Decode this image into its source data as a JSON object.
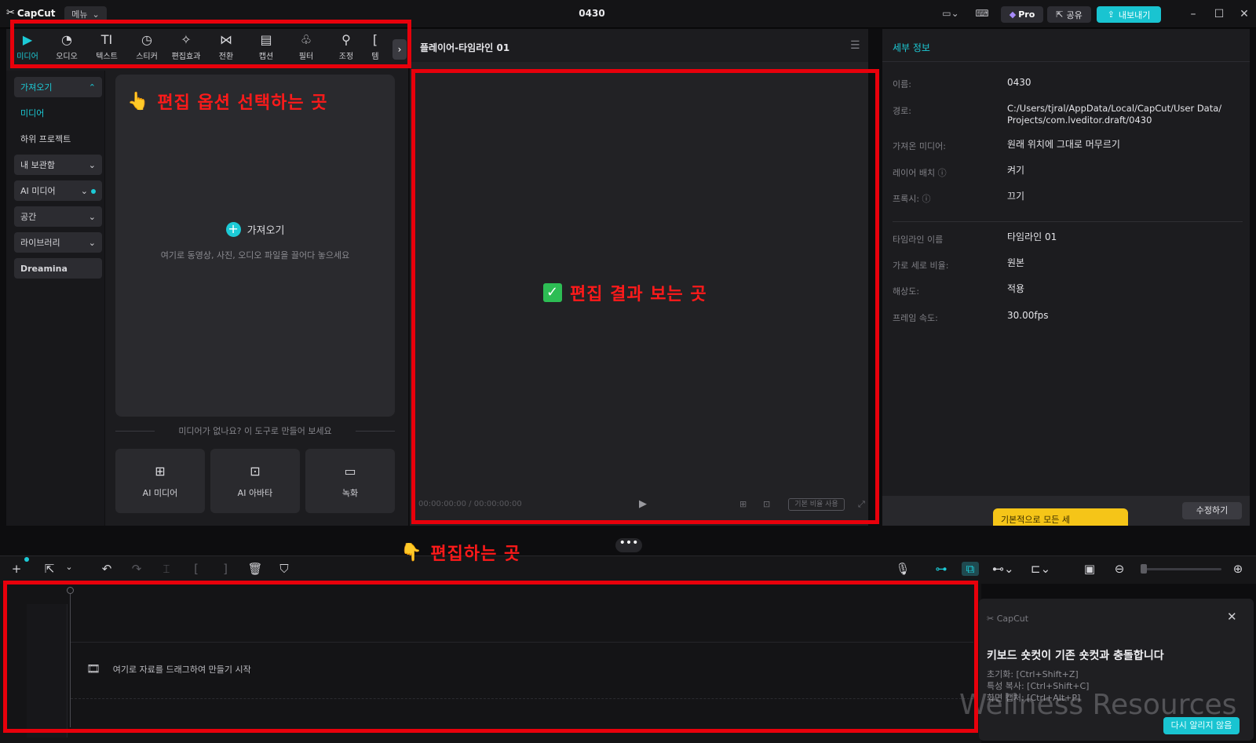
{
  "titlebar": {
    "logo": "CapCut",
    "menu_label": "메뉴",
    "project_title": "0430",
    "pro_label": "Pro",
    "share_label": "공유",
    "export_label": "내보내기"
  },
  "tool_tabs": [
    {
      "label": "미디어",
      "icon": "media-icon",
      "glyph": "▶",
      "active": true
    },
    {
      "label": "오디오",
      "icon": "audio-icon",
      "glyph": "◔"
    },
    {
      "label": "텍스트",
      "icon": "text-icon",
      "glyph": "TI"
    },
    {
      "label": "스티커",
      "icon": "sticker-icon",
      "glyph": "◷"
    },
    {
      "label": "편집효과",
      "icon": "effects-icon",
      "glyph": "✧"
    },
    {
      "label": "전환",
      "icon": "transition-icon",
      "glyph": "⋈"
    },
    {
      "label": "캡션",
      "icon": "caption-icon",
      "glyph": "▤"
    },
    {
      "label": "필터",
      "icon": "filter-icon",
      "glyph": "♧"
    },
    {
      "label": "조정",
      "icon": "adjust-icon",
      "glyph": "⚲"
    },
    {
      "label": "템",
      "icon": "template-icon",
      "glyph": "["
    }
  ],
  "side_nav": {
    "import": "가져오기",
    "media": "미디어",
    "sub_project": "하위 프로젝트",
    "my_storage": "내 보관함",
    "ai_media": "AI 미디어",
    "space": "공간",
    "library": "라이브러리",
    "dreamina": "Dreamina"
  },
  "import_area": {
    "label": "가져오기",
    "hint": "여기로 동영상, 사진, 오디오 파일을 끌어다 놓으세요",
    "divider": "미디어가 없나요? 이 도구로 만들어 보세요"
  },
  "tool_cards": [
    {
      "label": "AI 미디어",
      "glyph": "⊞"
    },
    {
      "label": "AI 아바타",
      "glyph": "⊡"
    },
    {
      "label": "녹화",
      "glyph": "▭"
    }
  ],
  "player": {
    "title": "플레이어-타임라인 01",
    "time": "00:00:00:00 / 00:00:00:00",
    "ratio": "기본 비율 사용"
  },
  "details": {
    "title": "세부 정보",
    "rows": [
      {
        "label": "이름:",
        "value": "0430"
      },
      {
        "label": "경로:",
        "value": "C:/Users/tjral/AppData/Local/CapCut/User Data/ Projects/com.lveditor.draft/0430"
      },
      {
        "label": "가져온 미디어:",
        "value": "원래 위치에 그대로 머무르기"
      },
      {
        "label": "레이어 배치 ⓘ",
        "value": "켜기"
      },
      {
        "label": "프록시: ⓘ",
        "value": "끄기"
      },
      {
        "label": "타임라인 이름",
        "value": "타임라인 01"
      },
      {
        "label": "가로 세로 비율:",
        "value": "원본"
      },
      {
        "label": "해상도:",
        "value": "적용"
      },
      {
        "label": "프레임 속도:",
        "value": "30.00fps"
      }
    ],
    "tip_button": "기본적으로 모든 세",
    "edit_button": "수정하기"
  },
  "timeline": {
    "hint": "여기로 자료를 드래그하여 만들기 시작"
  },
  "toast": {
    "logo": "CapCut",
    "title": "키보드 숏컷이 기존 숏컷과 충돌합니다",
    "lines": [
      "초기화: [Ctrl+Shift+Z]",
      "특성 복사: [Ctrl+Shift+C]",
      "화면 캡처: [Ctrl+Alt+P]"
    ],
    "button": "다시 알리지 않음"
  },
  "watermark": "Wellness Resources",
  "annotations": {
    "select_options": "편집 옵션 선택하는 곳",
    "view_result": "편집 결과 보는 곳",
    "edit_here": "편집하는 곳"
  },
  "colors": {
    "accent": "#1ccad6",
    "annotation": "#e8000b",
    "pro_gold": "#f5c518"
  }
}
